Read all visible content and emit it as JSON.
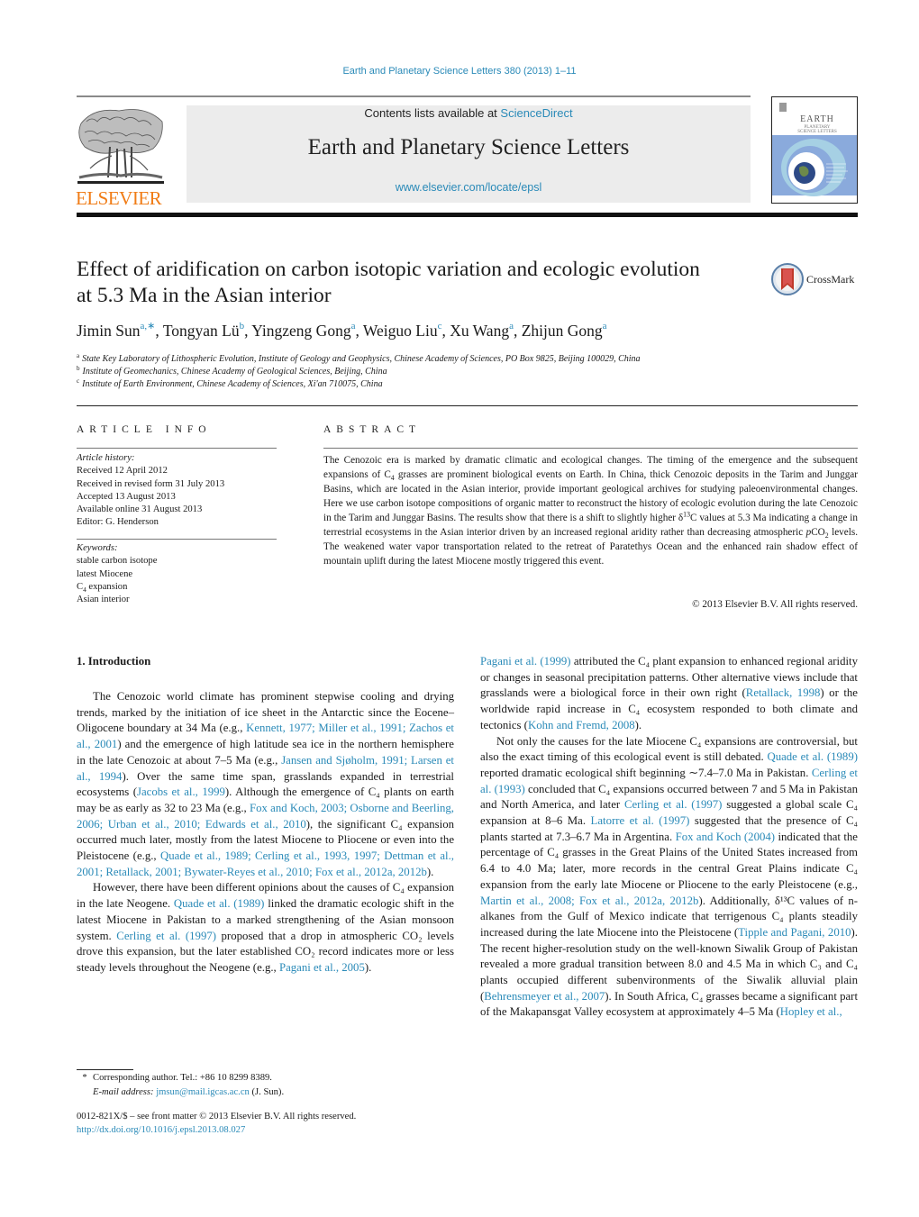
{
  "header": {
    "journal_ref": "Earth and Planetary Science Letters 380 (2013) 1–11",
    "contents_prefix": "Contents lists available at ",
    "contents_link": "ScienceDirect",
    "journal_name": "Earth and Planetary Science Letters",
    "journal_url": "www.elsevier.com/locate/epsl",
    "publisher_logo": "ELSEVIER",
    "cover_title_1": "EARTH",
    "cover_title_2": "PLANETARY",
    "cover_title_3": "SCIENCE LETTERS"
  },
  "colors": {
    "link": "#2a8ab8",
    "elsevier_orange": "#f07c16",
    "masthead_bg": "#ececec"
  },
  "article": {
    "title": "Effect of aridification on carbon isotopic variation and ecologic evolution at 5.3 Ma in the Asian interior",
    "crossmark_label": "CrossMark",
    "authors": [
      {
        "name": "Jimin Sun",
        "sup": "a,∗"
      },
      {
        "name": "Tongyan Lü",
        "sup": "b"
      },
      {
        "name": "Yingzeng Gong",
        "sup": "a"
      },
      {
        "name": "Weiguo Liu",
        "sup": "c"
      },
      {
        "name": "Xu Wang",
        "sup": "a"
      },
      {
        "name": "Zhijun Gong",
        "sup": "a"
      }
    ],
    "affiliations": [
      {
        "key": "a",
        "text": "State Key Laboratory of Lithospheric Evolution, Institute of Geology and Geophysics, Chinese Academy of Sciences, PO Box 9825, Beijing 100029, China"
      },
      {
        "key": "b",
        "text": "Institute of Geomechanics, Chinese Academy of Geological Sciences, Beijing, China"
      },
      {
        "key": "c",
        "text": "Institute of Earth Environment, Chinese Academy of Sciences, Xi'an 710075, China"
      }
    ]
  },
  "article_info": {
    "heading": "ARTICLE INFO",
    "history_label": "Article history:",
    "history": [
      "Received 12 April 2012",
      "Received in revised form 31 July 2013",
      "Accepted 13 August 2013",
      "Available online 31 August 2013",
      "Editor: G. Henderson"
    ],
    "keywords_label": "Keywords:",
    "keywords": [
      "stable carbon isotope",
      "latest Miocene",
      "C4 expansion",
      "Asian interior"
    ]
  },
  "abstract": {
    "heading": "ABSTRACT",
    "text_1": "The Cenozoic era is marked by dramatic climatic and ecological changes. The timing of the emergence and the subsequent expansions of C",
    "text_2": " grasses are prominent biological events on Earth. In China, thick Cenozoic deposits in the Tarim and Junggar Basins, which are located in the Asian interior, provide important geological archives for studying paleoenvironmental changes. Here we use carbon isotope compositions of organic matter to reconstruct the history of ecologic evolution during the late Cenozoic in the Tarim and Junggar Basins. The results show that there is a shift to slightly higher δ",
    "text_3": "C values at 5.3 Ma indicating a change in terrestrial ecosystems in the Asian interior driven by an increased regional aridity rather than decreasing atmospheric ",
    "text_4": " levels. The weakened water vapor transportation related to the retreat of Paratethys Ocean and the enhanced rain shadow effect of mountain uplift during the latest Miocene mostly triggered this event.",
    "copyright": "© 2013 Elsevier B.V. All rights reserved."
  },
  "intro": {
    "section_title": "1. Introduction",
    "p1": [
      {
        "t": "The Cenozoic world climate has prominent stepwise cooling and drying trends, marked by the initiation of ice sheet in the Antarctic since the Eocene–Oligocene boundary at 34 Ma (e.g., "
      },
      {
        "l": "Kennett, 1977; Miller et al., 1991; Zachos et al., 2001"
      },
      {
        "t": ") and the emergence of high latitude sea ice in the northern hemisphere in the late Cenozoic at about 7–5 Ma (e.g., "
      },
      {
        "l": "Jansen and Sjøholm, 1991; Larsen et al., 1994"
      },
      {
        "t": "). Over the same time span, grasslands expanded in terrestrial ecosystems ("
      },
      {
        "l": "Jacobs et al., 1999"
      },
      {
        "t": "). Although the emergence of C₄ plants on earth may be as early as 32 to 23 Ma (e.g., "
      },
      {
        "l": "Fox and Koch, 2003; Osborne and Beerling, 2006; Urban et al., 2010; Edwards et al., 2010"
      },
      {
        "t": "), the significant C₄ expansion occurred much later, mostly from the latest Miocene to Pliocene or even into the Pleistocene (e.g., "
      },
      {
        "l": "Quade et al., 1989; Cerling et al., 1993, 1997; Dettman et al., 2001; Retallack, 2001; Bywater-Reyes et al., 2010; Fox et al., 2012a, 2012b"
      },
      {
        "t": ")."
      }
    ],
    "p2": [
      {
        "t": "However, there have been different opinions about the causes of C₄ expansion in the late Neogene. "
      },
      {
        "l": "Quade et al. (1989)"
      },
      {
        "t": " linked the dramatic ecologic shift in the latest Miocene in Pakistan to a marked strengthening of the Asian monsoon system. "
      },
      {
        "l": "Cerling et al. (1997)"
      },
      {
        "t": " proposed that a drop in atmospheric CO₂ levels drove this expansion, but the later established CO₂ record indicates more or less steady levels throughout the Neogene (e.g., "
      },
      {
        "l": "Pagani et al., 2005"
      },
      {
        "t": ")."
      }
    ],
    "p3": [
      {
        "l": "Pagani et al. (1999)"
      },
      {
        "t": " attributed the C₄ plant expansion to enhanced regional aridity or changes in seasonal precipitation patterns. Other alternative views include that grasslands were a biological force in their own right ("
      },
      {
        "l": "Retallack, 1998"
      },
      {
        "t": ") or the worldwide rapid increase in C₄ ecosystem responded to both climate and tectonics ("
      },
      {
        "l": "Kohn and Fremd, 2008"
      },
      {
        "t": ")."
      }
    ],
    "p4": [
      {
        "t": "Not only the causes for the late Miocene C₄ expansions are controversial, but also the exact timing of this ecological event is still debated. "
      },
      {
        "l": "Quade et al. (1989)"
      },
      {
        "t": " reported dramatic ecological shift beginning ∼7.4–7.0 Ma in Pakistan. "
      },
      {
        "l": "Cerling et al. (1993)"
      },
      {
        "t": " concluded that C₄ expansions occurred between 7 and 5 Ma in Pakistan and North America, and later "
      },
      {
        "l": "Cerling et al. (1997)"
      },
      {
        "t": " suggested a global scale C₄ expansion at 8–6 Ma. "
      },
      {
        "l": "Latorre et al. (1997)"
      },
      {
        "t": " suggested that the presence of C₄ plants started at 7.3–6.7 Ma in Argentina. "
      },
      {
        "l": "Fox and Koch (2004)"
      },
      {
        "t": " indicated that the percentage of C₄ grasses in the Great Plains of the United States increased from 6.4 to 4.0 Ma; later, more records in the central Great Plains indicate C₄ expansion from the early late Miocene or Pliocene to the early Pleistocene (e.g., "
      },
      {
        "l": "Martin et al., 2008; Fox et al., 2012a, 2012b"
      },
      {
        "t": "). Additionally, δ¹³C values of n-alkanes from the Gulf of Mexico indicate that terrigenous C₄ plants steadily increased during the late Miocene into the Pleistocene ("
      },
      {
        "l": "Tipple and Pagani, 2010"
      },
      {
        "t": "). The recent higher-resolution study on the well-known Siwalik Group of Pakistan revealed a more gradual transition between 8.0 and 4.5 Ma in which C₃ and C₄ plants occupied different subenvironments of the Siwalik alluvial plain ("
      },
      {
        "l": "Behrensmeyer et al., 2007"
      },
      {
        "t": "). In South Africa, C₄ grasses became a significant part of the Makapansgat Valley ecosystem at approximately 4–5 Ma ("
      },
      {
        "l": "Hopley et al.,"
      }
    ]
  },
  "footnote": {
    "star": "*",
    "corresponding": "Corresponding author. Tel.: +86 10 8299 8389.",
    "email_label": "E-mail address:",
    "email": "jmsun@mail.igcas.ac.cn",
    "email_suffix": " (J. Sun).",
    "front_matter": "0012-821X/$ – see front matter  © 2013 Elsevier B.V. All rights reserved.",
    "doi": "http://dx.doi.org/10.1016/j.epsl.2013.08.027"
  }
}
